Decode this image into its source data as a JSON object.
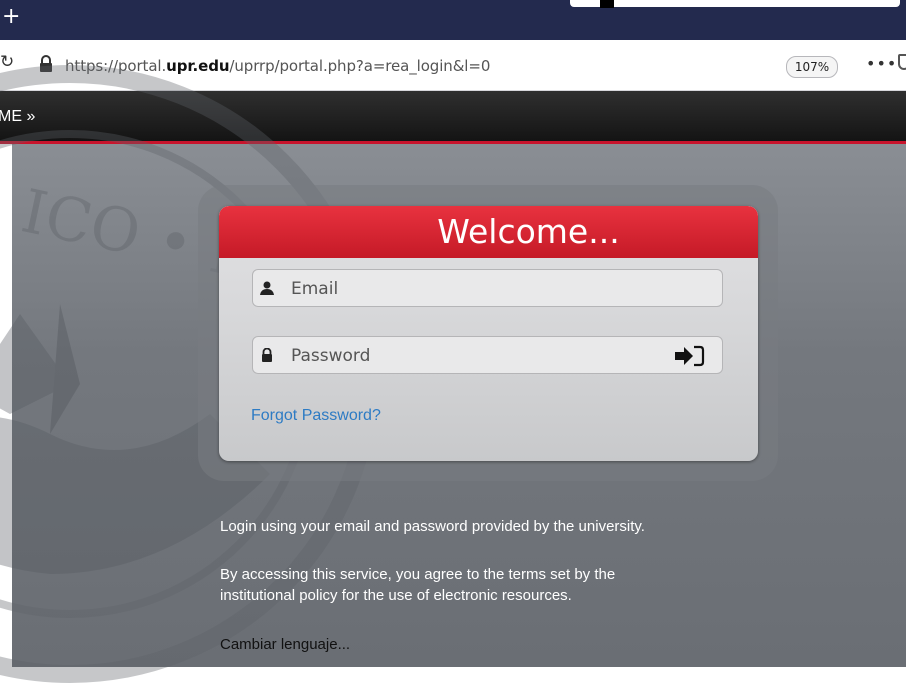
{
  "browser": {
    "new_tab_glyph": "+",
    "reload_icon": "reload-icon",
    "url_prefix": "https://portal.",
    "url_domain": "upr.edu",
    "url_path": "/uprrp/portal.php?a=rea_login&l=0",
    "zoom": "107%",
    "more_glyph": "•••"
  },
  "nav": {
    "home_label": "ME »"
  },
  "login": {
    "title": "Welcome...",
    "email_placeholder": "Email",
    "password_placeholder": "Password",
    "forgot_label": "Forgot Password?"
  },
  "info": {
    "line1": "Login using your email and password provided by the university.",
    "line2": "By accessing this service, you agree to the terms set by the institutional policy for the use of electronic resources.",
    "language_link": "Cambiar lenguaje..."
  },
  "colors": {
    "tab_strip": "#232a4e",
    "header_red": "#d92230",
    "link_blue": "#2d7bc4",
    "nav_border": "#c8142c"
  }
}
